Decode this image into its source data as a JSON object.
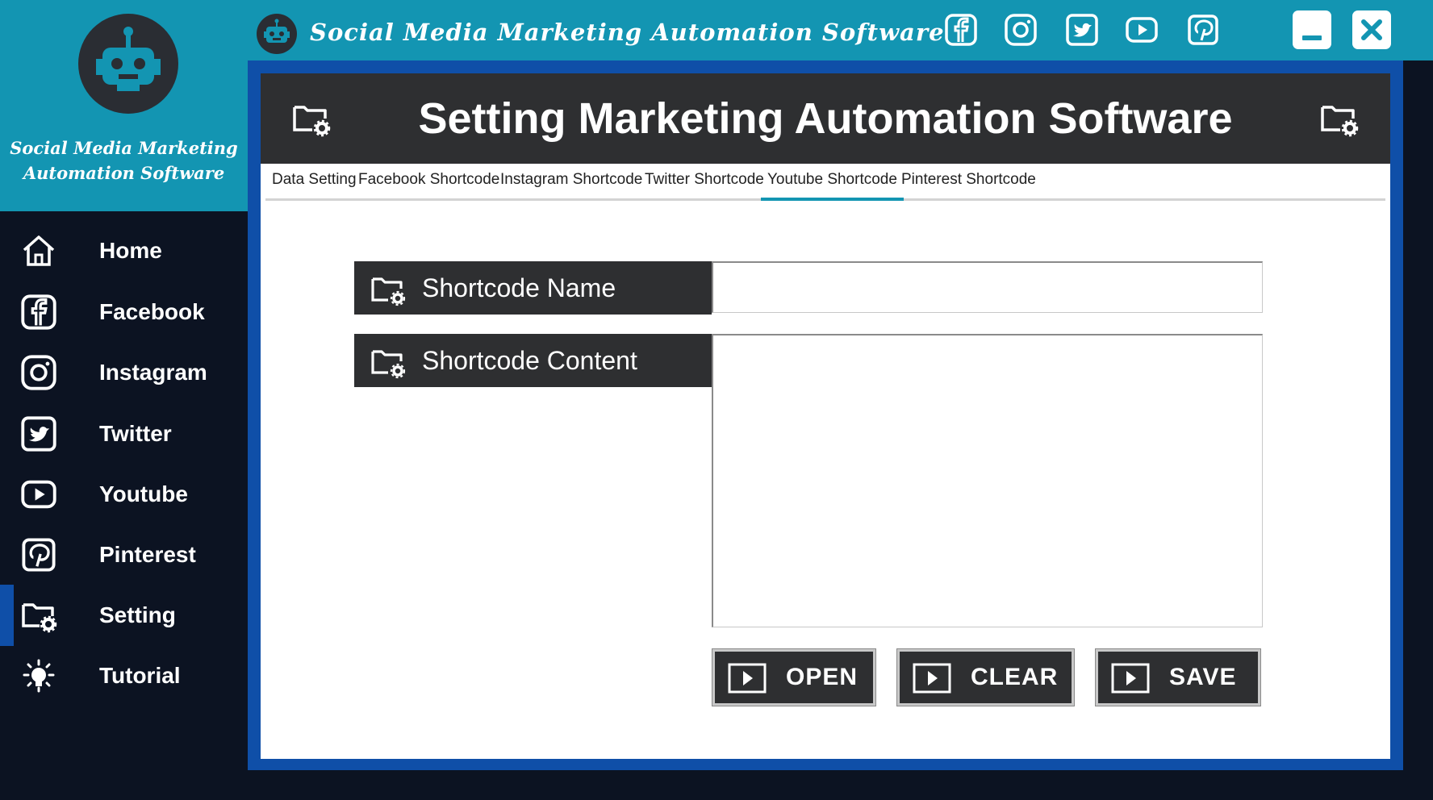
{
  "window": {
    "title": "Social Media Marketing Automation Software",
    "social_icons": [
      "facebook-icon",
      "instagram-icon",
      "twitter-icon",
      "youtube-icon",
      "pinterest-icon"
    ],
    "controls": [
      "minimize-icon",
      "close-icon"
    ]
  },
  "brand": {
    "line1": "Social Media Marketing",
    "line2": "Automation Software"
  },
  "sidebar": {
    "items": [
      {
        "label": "Home",
        "icon": "home-icon"
      },
      {
        "label": "Facebook",
        "icon": "facebook-icon"
      },
      {
        "label": "Instagram",
        "icon": "instagram-icon"
      },
      {
        "label": "Twitter",
        "icon": "twitter-icon"
      },
      {
        "label": "Youtube",
        "icon": "youtube-icon"
      },
      {
        "label": "Pinterest",
        "icon": "pinterest-icon"
      },
      {
        "label": "Setting",
        "icon": "folder-gear-icon",
        "active": true
      },
      {
        "label": "Tutorial",
        "icon": "lightbulb-icon"
      }
    ]
  },
  "main": {
    "title": "Setting Marketing Automation Software",
    "tabs": [
      {
        "label": "Data Setting"
      },
      {
        "label": "Facebook Shortcode"
      },
      {
        "label": "Instagram Shortcode"
      },
      {
        "label": "Twitter Shortcode"
      },
      {
        "label": "Youtube Shortcode",
        "active": true
      },
      {
        "label": "Pinterest Shortcode"
      }
    ],
    "form": {
      "name_label": "Shortcode Name",
      "name_value": "",
      "content_label": "Shortcode Content",
      "content_value": ""
    },
    "buttons": {
      "open": "OPEN",
      "clear": "CLEAR",
      "save": "SAVE"
    }
  },
  "colors": {
    "accent": "#1395b2",
    "frame": "#0f4fa8",
    "dark": "#2e2f31",
    "sidebar_bg": "#0c1322"
  }
}
